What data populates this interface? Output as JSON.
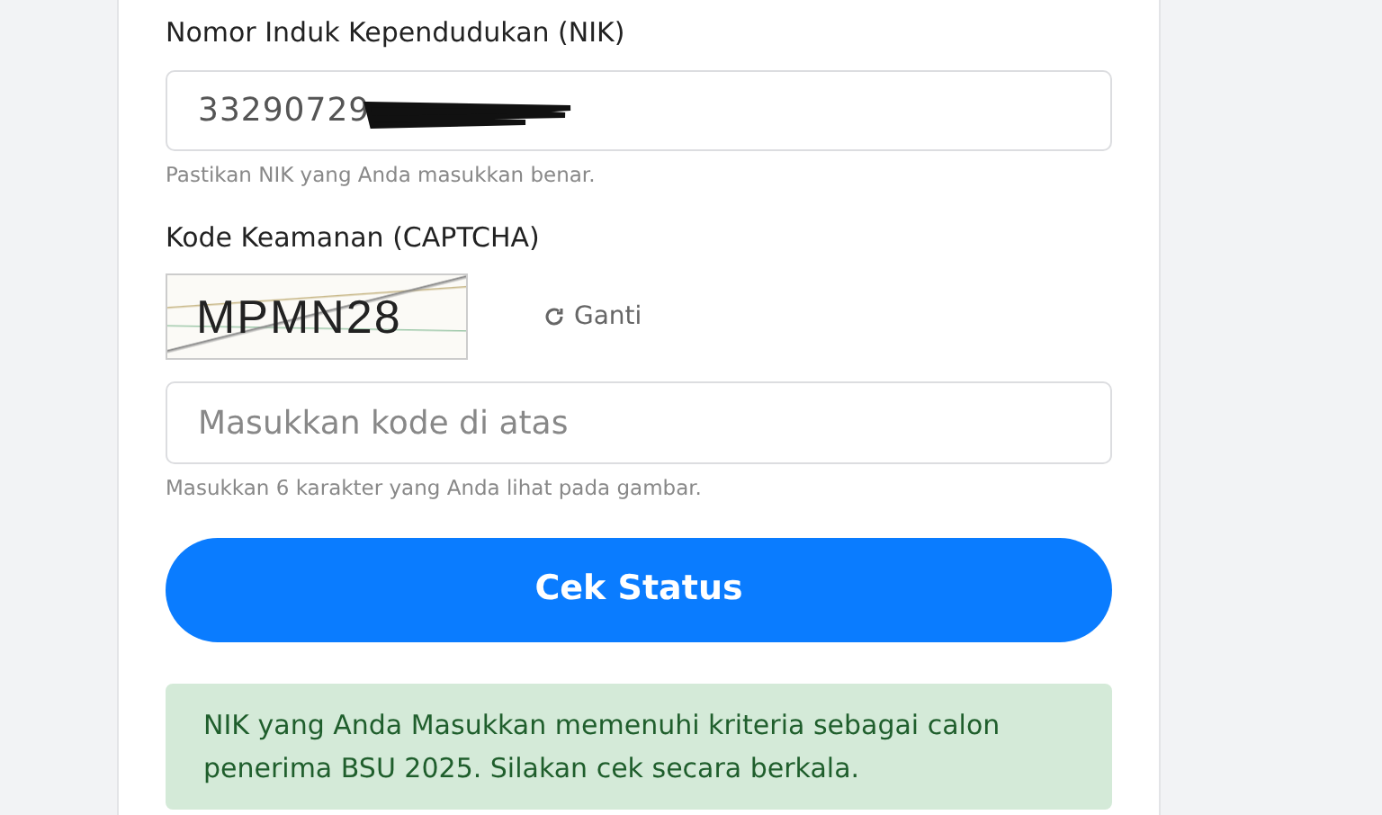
{
  "nik_field": {
    "label": "Nomor Induk Kependudukan (NIK)",
    "value": "33290729",
    "redacted": true,
    "hint": "Pastikan NIK yang Anda masukkan benar."
  },
  "captcha": {
    "label": "Kode Keamanan (CAPTCHA)",
    "code": "MPMN28",
    "refresh_label": "Ganti",
    "placeholder": "Masukkan kode di atas",
    "hint": "Masukkan 6 karakter yang Anda lihat pada gambar."
  },
  "submit_button": "Cek Status",
  "result": {
    "kind": "success",
    "message": "NIK yang Anda Masukkan memenuhi kriteria sebagai calon penerima BSU 2025. Silakan cek secara berkala."
  }
}
